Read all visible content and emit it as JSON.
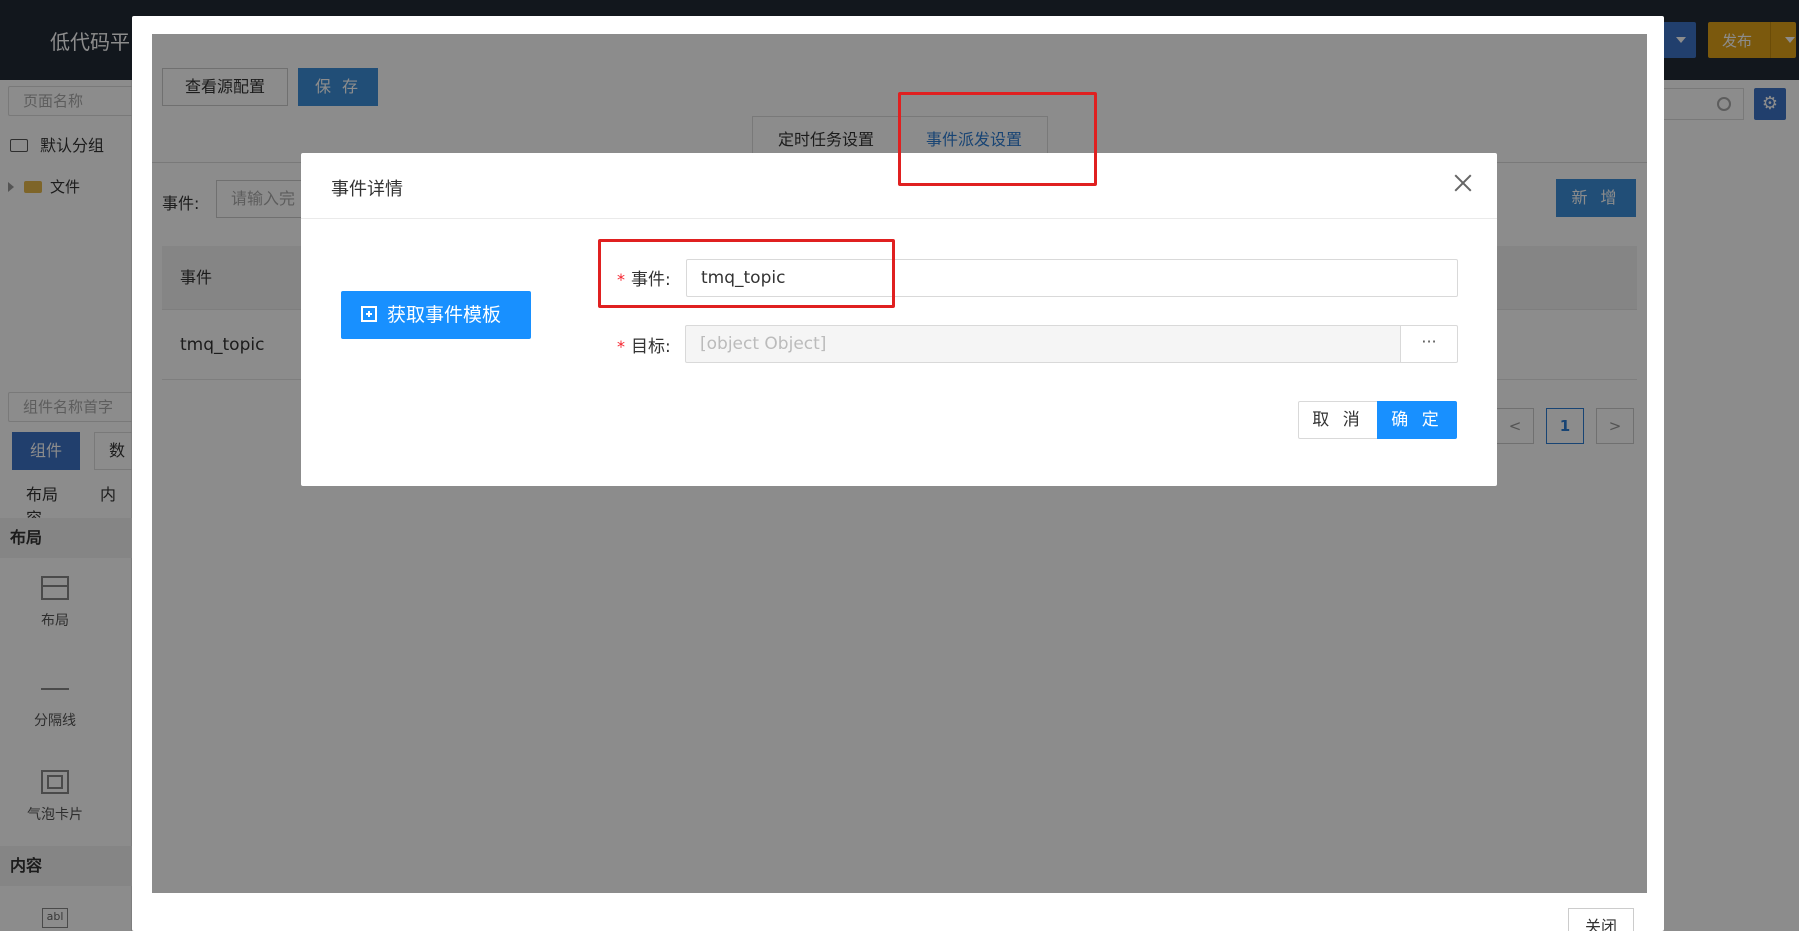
{
  "app": {
    "title": "低代码平",
    "publish_label": "发布"
  },
  "left_panel": {
    "page_name_placeholder": "页面名称",
    "group_label": "默认分组",
    "file_label": "文件",
    "component_search_placeholder": "组件名称首字",
    "tabs": [
      "组件",
      "数"
    ],
    "sub_tabs": [
      "布局",
      "内容"
    ],
    "sections": [
      {
        "title": "布局",
        "items": [
          "布局",
          "分隔线",
          "气泡卡片"
        ]
      },
      {
        "title": "内容",
        "items": []
      }
    ],
    "last_icon_glyph": "abl"
  },
  "right_panel": {
    "settings_icon": "gear-icon"
  },
  "outer_modal": {
    "view_source_label": "查看源配置",
    "save_label": "保 存",
    "tabs": [
      {
        "label": "定时任务设置",
        "active": false
      },
      {
        "label": "事件派发设置",
        "active": true
      }
    ],
    "filter_label": "事件:",
    "filter_placeholder": "请输入完",
    "new_label": "新 增",
    "table": {
      "header": "事件",
      "rows": [
        "tmq_topic"
      ]
    },
    "pagination": {
      "prev": "<",
      "current": "1",
      "next": ">"
    },
    "close_label": "关闭"
  },
  "dialog": {
    "title": "事件详情",
    "template_button": "获取事件模板",
    "fields": {
      "event_label": "事件:",
      "event_value": "tmq_topic",
      "target_label": "目标:",
      "target_value": "[object Object]",
      "target_picker": "···"
    },
    "cancel_label": "取 消",
    "ok_label": "确 定",
    "required_mark": "*"
  },
  "colors": {
    "primary": "#1890ff",
    "header_bg": "#222a36",
    "publish": "#e0a318",
    "annotation": "#e02020"
  }
}
